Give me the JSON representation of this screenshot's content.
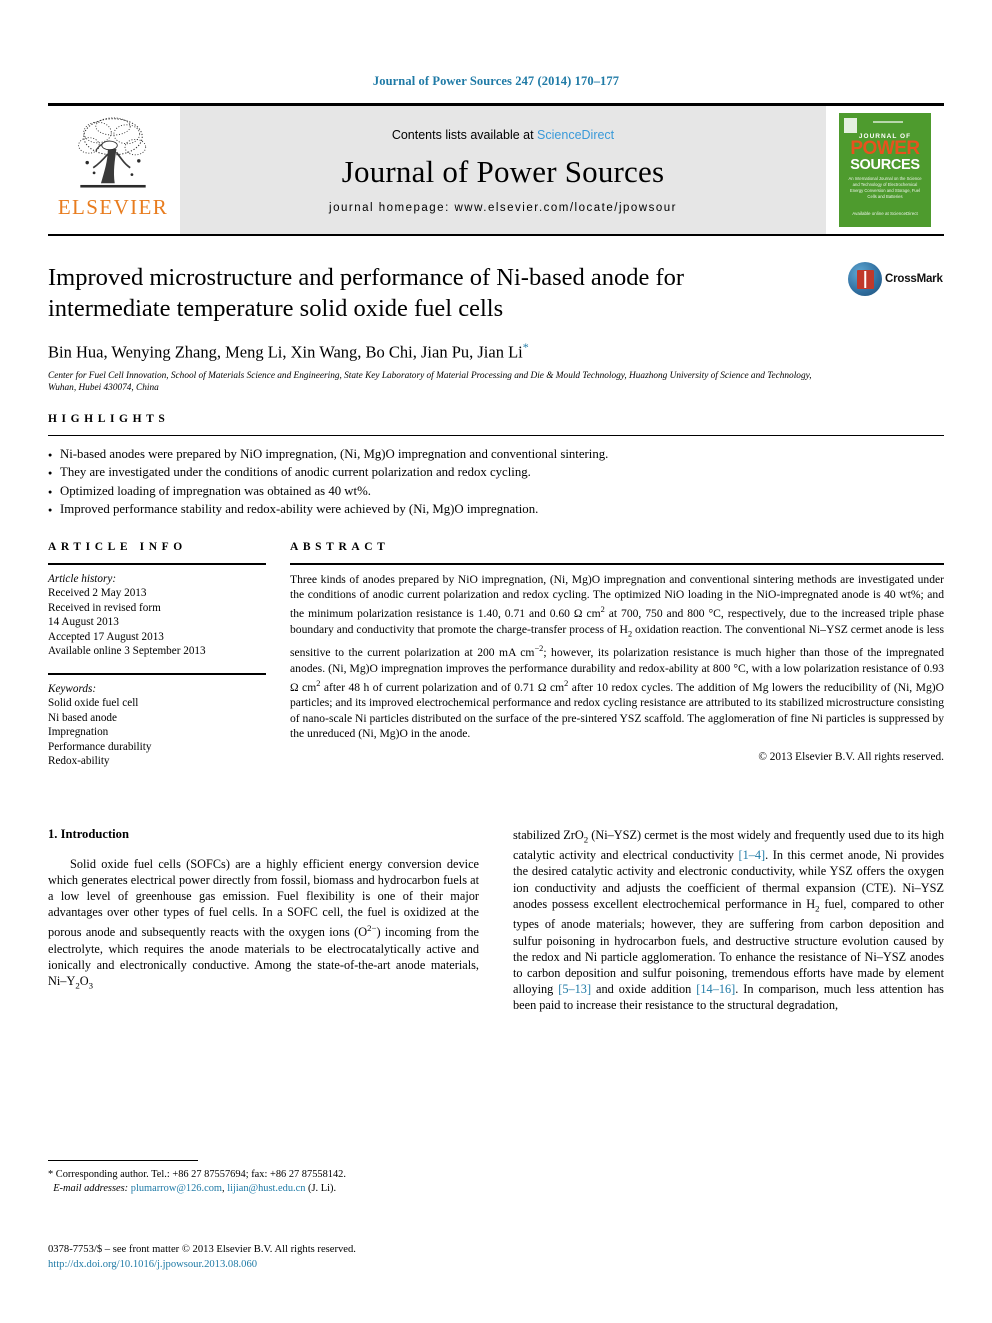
{
  "running_head": "Journal of Power Sources 247 (2014) 170–177",
  "masthead": {
    "elsevier_wordmark": "ELSEVIER",
    "contents_prefix": "Contents lists available at ",
    "sciencedirect": "ScienceDirect",
    "journal_title": "Journal of Power Sources",
    "homepage": "journal homepage: www.elsevier.com/locate/jpowsour",
    "cover": {
      "line1": "JOURNAL OF",
      "line2": "POWER",
      "line3": "SOURCES",
      "subtitle": "An International Journal on the Science and Technology of Electrochemical Energy Conversion and Storage, Fuel Cells and Batteries",
      "footer": "Available online at ScienceDirect"
    }
  },
  "article": {
    "title": "Improved microstructure and performance of Ni-based anode for intermediate temperature solid oxide fuel cells",
    "authors": "Bin Hua, Wenying Zhang, Meng Li, Xin Wang, Bo Chi, Jian Pu, Jian Li",
    "author_star": "*",
    "affiliation": "Center for Fuel Cell Innovation, School of Materials Science and Engineering, State Key Laboratory of Material Processing and Die & Mould Technology, Huazhong University of Science and Technology, Wuhan, Hubei 430074, China",
    "crossmark_label": "CrossMark"
  },
  "highlights": {
    "label": "HIGHLIGHTS",
    "items": [
      "Ni-based anodes were prepared by NiO impregnation, (Ni, Mg)O impregnation and conventional sintering.",
      "They are investigated under the conditions of anodic current polarization and redox cycling.",
      "Optimized loading of impregnation was obtained as 40 wt%.",
      "Improved performance stability and redox-ability were achieved by (Ni, Mg)O impregnation."
    ]
  },
  "article_info": {
    "label": "ARTICLE INFO",
    "history_title": "Article history:",
    "history": [
      "Received 2 May 2013",
      "Received in revised form",
      "14 August 2013",
      "Accepted 17 August 2013",
      "Available online 3 September 2013"
    ],
    "keywords_title": "Keywords:",
    "keywords": [
      "Solid oxide fuel cell",
      "Ni based anode",
      "Impregnation",
      "Performance durability",
      "Redox-ability"
    ]
  },
  "abstract": {
    "label": "ABSTRACT",
    "copyright": "© 2013 Elsevier B.V. All rights reserved."
  },
  "introduction": {
    "heading": "1. Introduction"
  },
  "footnotes": {
    "corresponding": "* Corresponding author. Tel.: +86 27 87557694; fax: +86 27 87558142.",
    "email_label": "E-mail addresses:",
    "email1": "plumarrow@126.com",
    "email2": "lijian@hust.edu.cn",
    "email_suffix": "(J. Li)."
  },
  "footer": {
    "issn_line": "0378-7753/$ – see front matter © 2013 Elsevier B.V. All rights reserved.",
    "doi": "http://dx.doi.org/10.1016/j.jpowsour.2013.08.060"
  },
  "colors": {
    "link": "#1f7aa6",
    "elsevier_orange": "#E87C1E",
    "sciencedirect_blue": "#3a9ad9",
    "cover_green": "#4e9b2e"
  }
}
